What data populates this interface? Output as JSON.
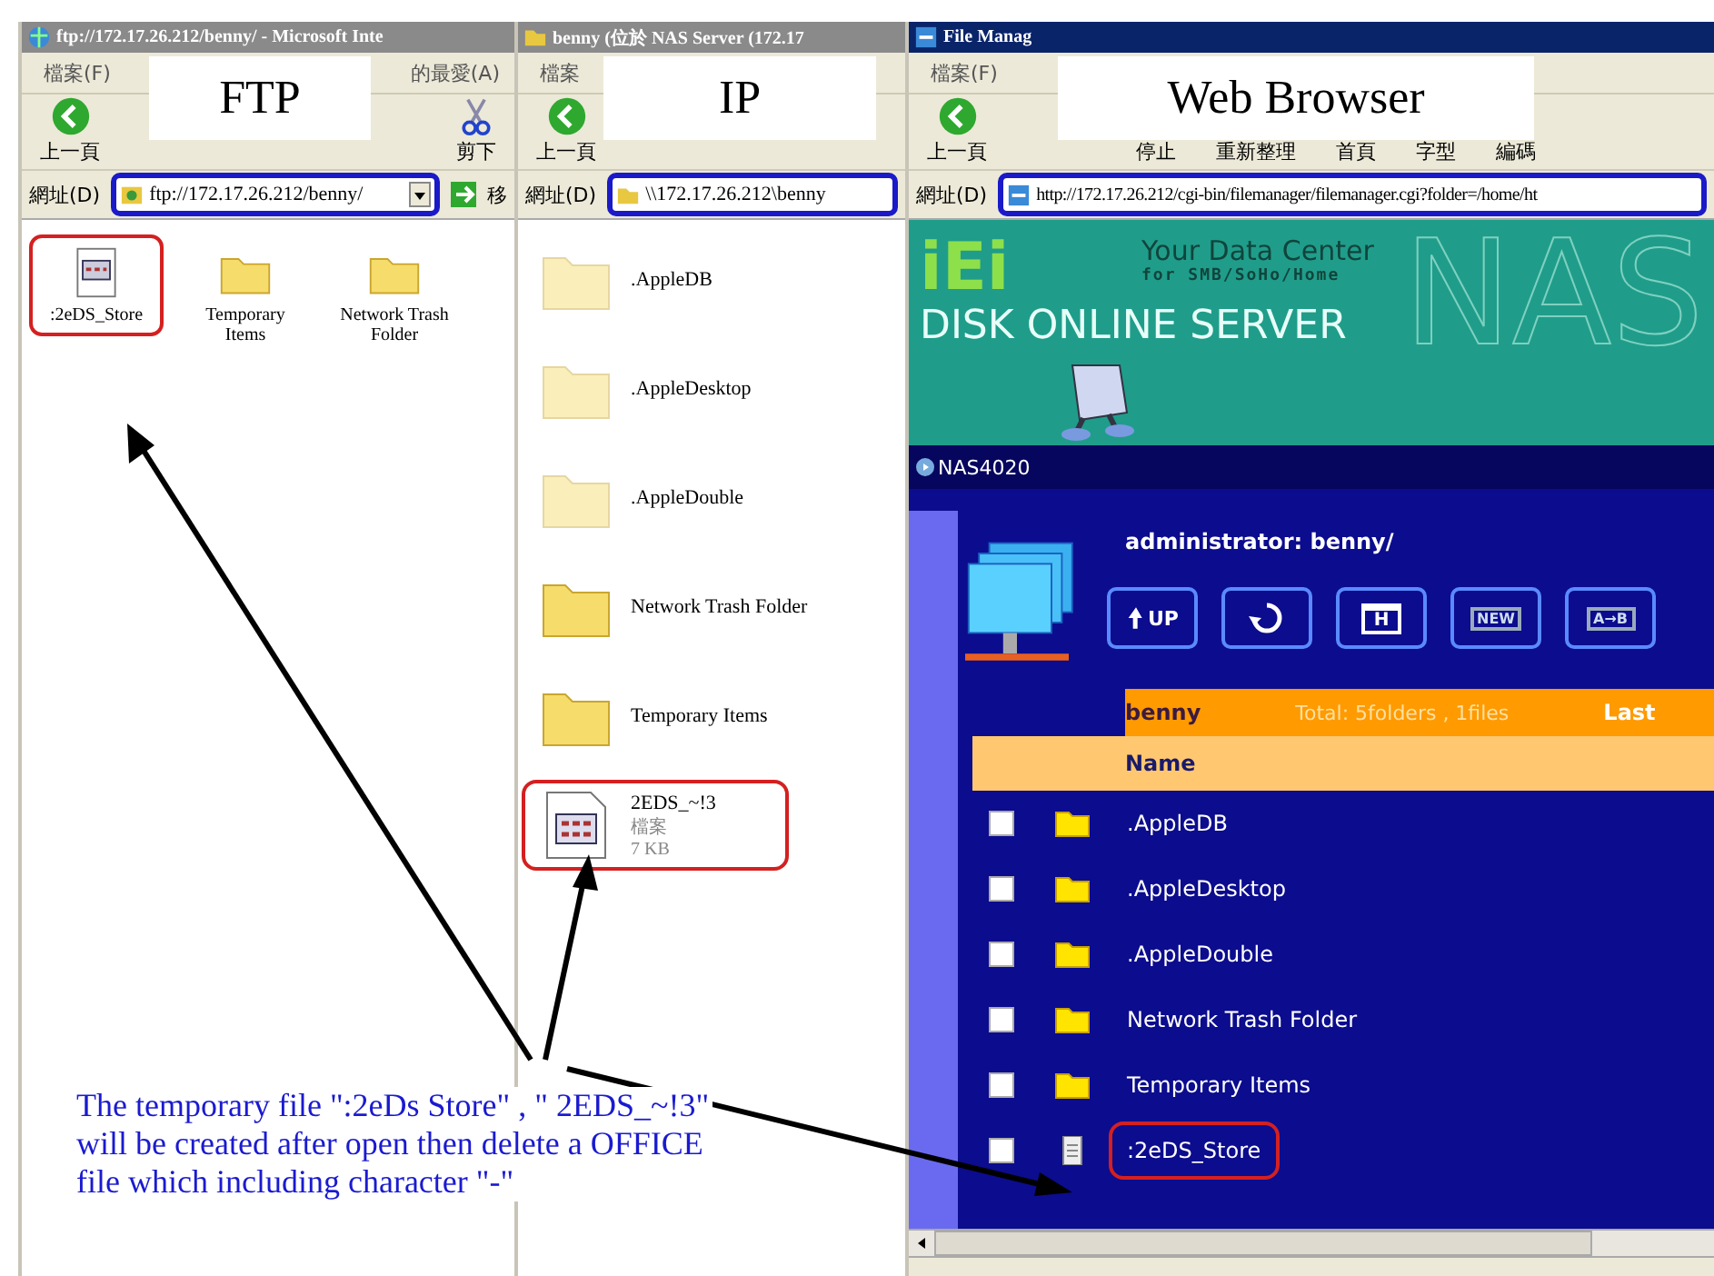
{
  "ftp_window": {
    "title": "ftp://172.17.26.212/benny/ - Microsoft Inte",
    "menu": [
      "檔案(F)",
      "的最愛(A)"
    ],
    "toolbar": [
      {
        "kind": "back",
        "label": "上一頁"
      },
      {
        "kind": "cut",
        "label": "剪下"
      }
    ],
    "address": {
      "label": "網址(D)",
      "value": "ftp://172.17.26.212/benny/",
      "go": "移",
      "outlined": true
    },
    "annotation": "FTP",
    "items": [
      {
        "kind": "file",
        "name": ":2eDS_Store",
        "outlined": true
      },
      {
        "kind": "folder",
        "name": "Temporary Items",
        "outlined": false
      },
      {
        "kind": "folder",
        "name": "Network Trash Folder",
        "outlined": false
      }
    ]
  },
  "ip_window": {
    "title": "benny (位於 NAS Server (172.17",
    "menu": [
      "檔案"
    ],
    "toolbar": [
      {
        "kind": "back",
        "label": "上一頁"
      }
    ],
    "address": {
      "label": "網址(D)",
      "value": "\\\\172.17.26.212\\benny",
      "outlined": true
    },
    "annotation": "IP",
    "items": [
      {
        "kind": "folder",
        "name": ".AppleDB",
        "faded": true,
        "outlined": false
      },
      {
        "kind": "folder",
        "name": ".AppleDesktop",
        "faded": true,
        "outlined": false
      },
      {
        "kind": "folder",
        "name": ".AppleDouble",
        "faded": true,
        "outlined": false
      },
      {
        "kind": "folder",
        "name": "Network Trash Folder",
        "faded": false,
        "outlined": false
      },
      {
        "kind": "folder",
        "name": "Temporary Items",
        "faded": false,
        "outlined": false
      },
      {
        "kind": "file",
        "name": "2EDS_~!3",
        "type": "檔案",
        "size": "7 KB",
        "faded": false,
        "outlined": true
      }
    ]
  },
  "browser_window": {
    "title": "File Manag",
    "menu": [
      "檔案(F)"
    ],
    "toolbar": [
      {
        "kind": "back",
        "label": "上一頁"
      },
      {
        "kind": "plain",
        "label": "停止"
      },
      {
        "kind": "plain",
        "label": "重新整理"
      },
      {
        "kind": "plain",
        "label": "首頁"
      },
      {
        "kind": "plain",
        "label": "字型"
      },
      {
        "kind": "encoding",
        "label": "編碼"
      }
    ],
    "address": {
      "label": "網址(D)",
      "value": "http://172.17.26.212/cgi-bin/filemanager/filemanager.cgi?folder=/home/ht",
      "outlined": true
    },
    "annotation": "Web Browser",
    "banner": {
      "logo": "iEi",
      "tagline": "Your Data Center",
      "subtitle": "for SMB/SoHo/Home",
      "product": "DISK ONLINE SERVER",
      "mark": "NAS"
    },
    "model": "NAS4020",
    "user_path": "administrator: benny/",
    "tools": [
      {
        "kind": "up",
        "label": "UP"
      },
      {
        "kind": "refresh"
      },
      {
        "kind": "home",
        "label": "H"
      },
      {
        "kind": "new",
        "label": "NEW"
      },
      {
        "kind": "copy",
        "label": "A→B"
      }
    ],
    "folder_bar": {
      "folder": "benny",
      "total": "Total: 5folders , 1files",
      "column_3": "Last"
    },
    "table": {
      "column": "Name",
      "rows": [
        {
          "kind": "folder",
          "name": ".AppleDB",
          "checked": false,
          "outlined": false
        },
        {
          "kind": "folder",
          "name": ".AppleDesktop",
          "checked": false,
          "outlined": false
        },
        {
          "kind": "folder",
          "name": ".AppleDouble",
          "checked": false,
          "outlined": false
        },
        {
          "kind": "folder",
          "name": "Network Trash Folder",
          "checked": false,
          "outlined": false
        },
        {
          "kind": "folder",
          "name": "Temporary Items",
          "checked": false,
          "outlined": false
        },
        {
          "kind": "file",
          "name": ":2eDS_Store",
          "checked": false,
          "outlined": true
        }
      ]
    }
  },
  "caption": "The temporary file \":2eDs Store\" , \" 2EDS_~!3\" will be created after open then delete a OFFICE file which including character \"-\""
}
